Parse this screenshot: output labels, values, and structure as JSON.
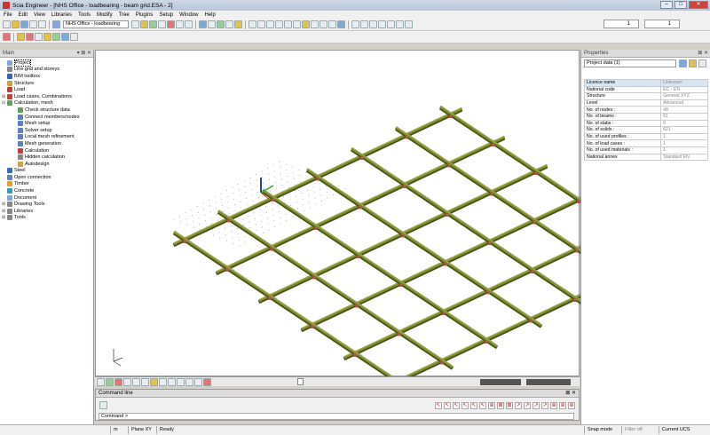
{
  "window": {
    "title": "Scia Engineer - [NHS Office - loadbearing - beam grid.ESA - 2]",
    "minimize": "–",
    "maximize": "□",
    "close": "✕"
  },
  "menu": [
    "File",
    "Edit",
    "View",
    "Libraries",
    "Tools",
    "Modify",
    "Tree",
    "Plugins",
    "Setup",
    "Window",
    "Help"
  ],
  "toolbar": {
    "project_select": "NHS Office - loadbearing",
    "spin1_value": "1",
    "spin2_value": "1"
  },
  "main_panel": {
    "title": "Main",
    "controls": "▾ ⊠ ✕",
    "tree": [
      {
        "label": "Project",
        "level": 0,
        "color": "#7fa7d8",
        "selected": true
      },
      {
        "label": "Line grid and storeys",
        "level": 0,
        "color": "#888888"
      },
      {
        "label": "BIM toolbox",
        "level": 0,
        "color": "#3060c0"
      },
      {
        "label": "Structure",
        "level": 0,
        "color": "#d0a040"
      },
      {
        "label": "Load",
        "level": 0,
        "color": "#c04040"
      },
      {
        "label": "Load cases, Combinations",
        "level": 0,
        "color": "#c04040",
        "expander": "⊞"
      },
      {
        "label": "Calculation, mesh",
        "level": 0,
        "color": "#60a060",
        "expander": "⊟"
      },
      {
        "label": "Check structure data",
        "level": 1,
        "color": "#60a060"
      },
      {
        "label": "Connect members/nodes",
        "level": 1,
        "color": "#6080c0"
      },
      {
        "label": "Mesh setup",
        "level": 1,
        "color": "#6080c0"
      },
      {
        "label": "Solver setup",
        "level": 1,
        "color": "#6080c0"
      },
      {
        "label": "Local mesh refinement",
        "level": 1,
        "color": "#6080c0"
      },
      {
        "label": "Mesh generation",
        "level": 1,
        "color": "#6080c0"
      },
      {
        "label": "Calculation",
        "level": 1,
        "color": "#c04040"
      },
      {
        "label": "Hidden calculation",
        "level": 1,
        "color": "#888888"
      },
      {
        "label": "Autodesign",
        "level": 1,
        "color": "#d0a040"
      },
      {
        "label": "Steel",
        "level": 0,
        "color": "#3070c0"
      },
      {
        "label": "Open connection",
        "level": 0,
        "color": "#6080c0"
      },
      {
        "label": "Timber",
        "level": 0,
        "color": "#e0a030"
      },
      {
        "label": "Concrete",
        "level": 0,
        "color": "#30a0b0"
      },
      {
        "label": "Document",
        "level": 0,
        "color": "#7fa7d8"
      },
      {
        "label": "Drawing Tools",
        "level": 0,
        "color": "#888888",
        "expander": "⊞"
      },
      {
        "label": "Libraries",
        "level": 0,
        "color": "#888888",
        "expander": "⊞"
      },
      {
        "label": "Tools",
        "level": 0,
        "color": "#888888",
        "expander": "⊞"
      }
    ]
  },
  "properties_panel": {
    "title": "Properties",
    "controls": "⊠ ✕",
    "selector": "Project data (1)",
    "rows": [
      {
        "name": "Licence name",
        "value": "Unknown"
      },
      {
        "name": "National code",
        "value": "EC - EN"
      },
      {
        "name": "Structure",
        "value": "General XYZ"
      },
      {
        "name": "Level",
        "value": "Advanced"
      },
      {
        "name": "No. of nodes :",
        "value": "48"
      },
      {
        "name": "No. of beams :",
        "value": "61"
      },
      {
        "name": "No. of slabs :",
        "value": "0"
      },
      {
        "name": "No. of solids :",
        "value": "621"
      },
      {
        "name": "No. of used profiles :",
        "value": "1"
      },
      {
        "name": "No. of load cases :",
        "value": "1"
      },
      {
        "name": "No. of used materials :",
        "value": "1"
      },
      {
        "name": "National annex",
        "value": "Standard EN"
      }
    ]
  },
  "command_line": {
    "title": "Command line",
    "controls": "⊠ ✕",
    "prompt": "Command >"
  },
  "status_bar": {
    "units": "m",
    "plane": "Plane XY",
    "state": "Ready",
    "snap": "Snap mode",
    "filter": "Filter off",
    "ucs": "Current UCS"
  },
  "colors": {
    "beam_fill": "#7d8a2c",
    "beam_dark": "#4a5418",
    "node_marker": "#c0504d"
  }
}
